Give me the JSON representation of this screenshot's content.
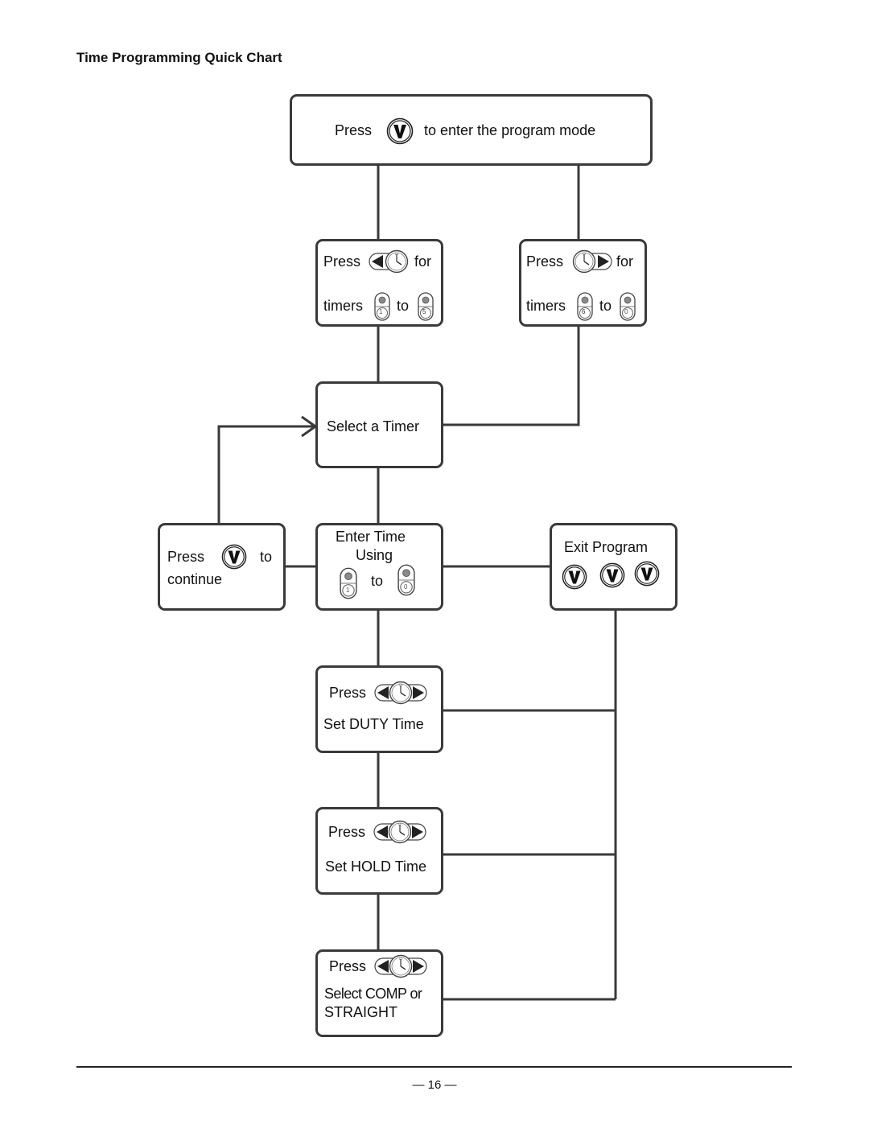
{
  "title": "Time Programming Quick Chart",
  "page_number": "— 16 —",
  "colors": {
    "line": "#3a3a3a",
    "text": "#111111",
    "led": "#8a8a8a"
  },
  "nodes": {
    "enter_program": {
      "press": "Press",
      "icon": "v-button-icon",
      "rest": "to enter the program mode"
    },
    "timers_left": {
      "press": "Press",
      "icon": "left-arrow-clock-icon",
      "for": "for",
      "timers": "timers",
      "to": "to",
      "from_key": "1",
      "to_key": "5"
    },
    "timers_right": {
      "press": "Press",
      "icon": "clock-right-arrow-icon",
      "for": "for",
      "timers": "timers",
      "to": "to",
      "from_key": "6",
      "to_key": "0"
    },
    "select_timer": {
      "label": "Select a Timer"
    },
    "continue": {
      "press": "Press",
      "icon": "v-button-icon",
      "to": "to",
      "continue": "continue"
    },
    "enter_time": {
      "line1": "Enter Time",
      "line2": "Using",
      "to": "to",
      "from_key": "1",
      "to_key": "0"
    },
    "exit_program": {
      "label": "Exit Program",
      "icon": "v-button-icon",
      "presses": 3
    },
    "duty": {
      "press": "Press",
      "icon": "left-right-clock-icon",
      "label": "Set DUTY Time"
    },
    "hold": {
      "press": "Press",
      "icon": "left-right-clock-icon",
      "label": "Set HOLD Time"
    },
    "comp": {
      "press": "Press",
      "icon": "left-right-clock-icon",
      "line1": "Select COMP or",
      "line2": "STRAIGHT"
    }
  }
}
